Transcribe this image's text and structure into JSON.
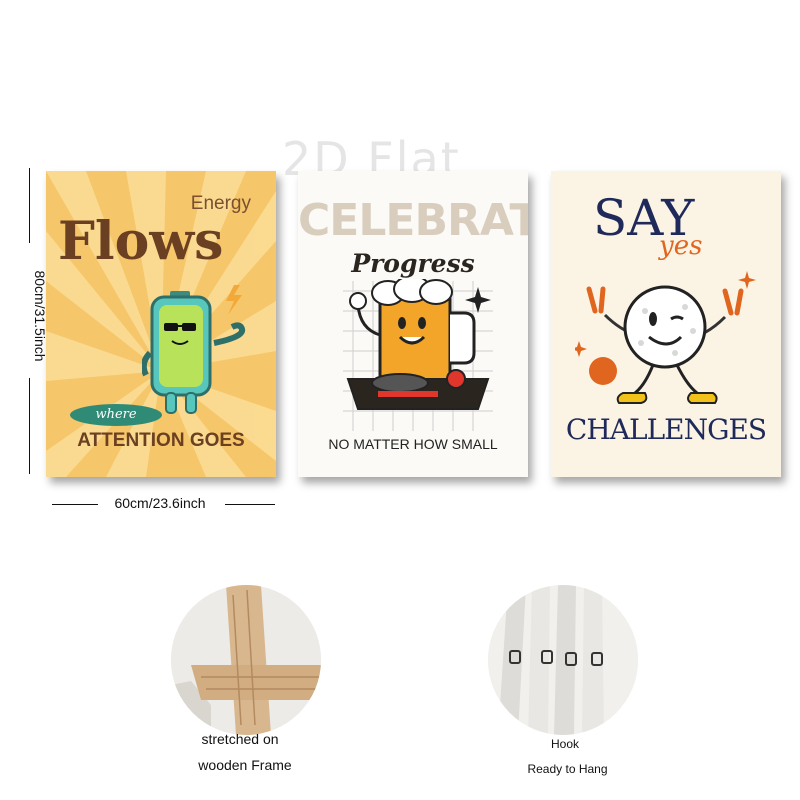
{
  "watermark": "2D Flat",
  "dimensions": {
    "height_label": "80cm/31.5inch",
    "width_label": "60cm/23.6inch"
  },
  "posters": [
    {
      "top_word": "Energy",
      "main_word": "Flows",
      "badge": "where",
      "bottom_text": "ATTENTION GOES",
      "bg_color": "#f6c66a",
      "text_color": "#6b3f22"
    },
    {
      "title": "CELEBRATE",
      "subtitle": "Progress",
      "bottom_text": "NO MATTER HOW SMALL",
      "bg_color": "#fbfaf6"
    },
    {
      "title": "SAY",
      "script_word": "yes",
      "bottom_text": "CHALLENGES",
      "bg_color": "#fbf3e4",
      "title_color": "#1f2a5a",
      "accent_color": "#e0651f"
    }
  ],
  "features": [
    {
      "icon": "wooden-frame-corner",
      "caption_line1": "stretched on",
      "caption_line2": "wooden Frame"
    },
    {
      "icon": "hanging-hook",
      "caption_line1": "Hook",
      "caption_line2": "Ready to Hang"
    }
  ]
}
